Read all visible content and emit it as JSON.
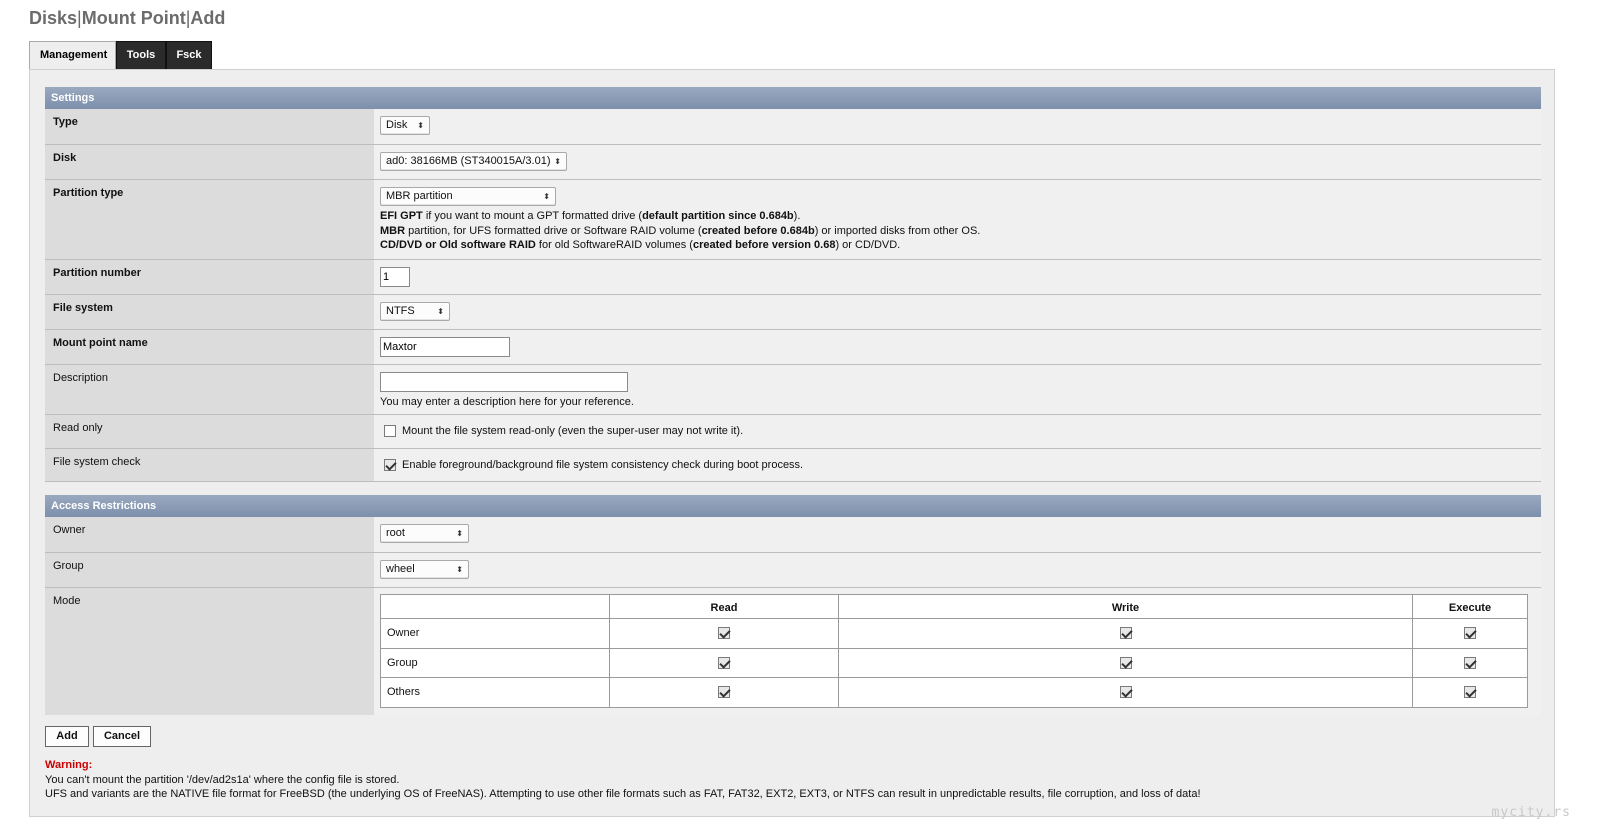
{
  "title": {
    "part1": "Disks",
    "part2": "Mount Point",
    "part3": "Add",
    "separator": "|"
  },
  "tabs": [
    {
      "label": "Management",
      "active": true
    },
    {
      "label": "Tools",
      "active": false
    },
    {
      "label": "Fsck",
      "active": false
    }
  ],
  "settings": {
    "header": "Settings",
    "type": {
      "label": "Type",
      "value": "Disk"
    },
    "disk": {
      "label": "Disk",
      "value": "ad0: 38166MB (ST340015A/3.01)"
    },
    "partition_type": {
      "label": "Partition type",
      "value": "MBR partition",
      "help1_b1": "EFI GPT",
      "help1_t1": " if you want to mount a GPT formatted drive (",
      "help1_b2": "default partition since 0.684b",
      "help1_t2": ").",
      "help2_b1": "MBR",
      "help2_t1": " partition, for UFS formatted drive or Software RAID volume (",
      "help2_b2": "created before 0.684b",
      "help2_t2": ") or imported disks from other OS.",
      "help3_b1": "CD/DVD or Old software RAID",
      "help3_t1": " for old SoftwareRAID volumes (",
      "help3_b2": "created before version 0.68",
      "help3_t2": ") or CD/DVD."
    },
    "partition_number": {
      "label": "Partition number",
      "value": "1"
    },
    "file_system": {
      "label": "File system",
      "value": "NTFS"
    },
    "mount_point_name": {
      "label": "Mount point name",
      "value": "Maxtor"
    },
    "description": {
      "label": "Description",
      "value": "",
      "help": "You may enter a description here for your reference."
    },
    "read_only": {
      "label": "Read only",
      "text": "Mount the file system read-only (even the super-user may not write it).",
      "checked": false
    },
    "fs_check": {
      "label": "File system check",
      "text": "Enable foreground/background file system consistency check during boot process.",
      "checked": true
    }
  },
  "access": {
    "header": "Access Restrictions",
    "owner": {
      "label": "Owner",
      "value": "root"
    },
    "group": {
      "label": "Group",
      "value": "wheel"
    },
    "mode": {
      "label": "Mode",
      "columns": [
        "",
        "Read",
        "Write",
        "Execute"
      ],
      "rows": [
        {
          "name": "Owner",
          "read": true,
          "write": true,
          "execute": true
        },
        {
          "name": "Group",
          "read": true,
          "write": true,
          "execute": true
        },
        {
          "name": "Others",
          "read": true,
          "write": true,
          "execute": true
        }
      ]
    }
  },
  "buttons": {
    "add": "Add",
    "cancel": "Cancel"
  },
  "warning": {
    "title": "Warning:",
    "line1": "You can't mount the partition '/dev/ad2s1a' where the config file is stored.",
    "line2": "UFS and variants are the NATIVE file format for FreeBSD (the underlying OS of FreeNAS). Attempting to use other file formats such as FAT, FAT32, EXT2, EXT3, or NTFS can result in unpredictable results, file corruption, and loss of data!"
  },
  "watermark": "mycity.rs"
}
